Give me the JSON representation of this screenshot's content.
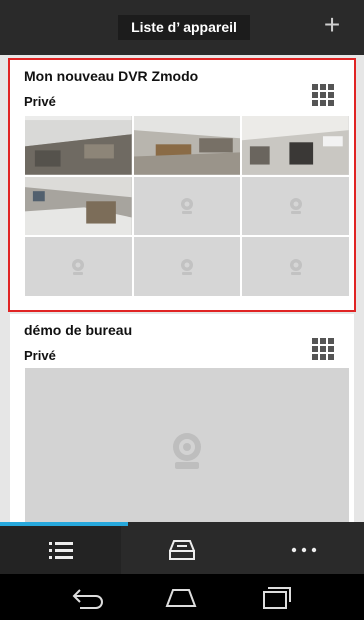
{
  "header": {
    "title": "Liste d’ appareil",
    "add_icon": "plus-icon"
  },
  "devices": [
    {
      "name": "Mon nouveau DVR Zmodo",
      "privacy": "Privé",
      "selected": true,
      "view_icon": "grid-view-icon",
      "cameras": [
        {
          "state": "live"
        },
        {
          "state": "live"
        },
        {
          "state": "live"
        },
        {
          "state": "live"
        },
        {
          "state": "offline"
        },
        {
          "state": "offline"
        },
        {
          "state": "offline"
        },
        {
          "state": "offline"
        },
        {
          "state": "offline"
        }
      ]
    },
    {
      "name": "démo de bureau",
      "privacy": "Privé",
      "selected": false,
      "view_icon": "grid-view-icon",
      "cameras": [
        {
          "state": "offline"
        }
      ]
    }
  ],
  "bottom_tabs": [
    {
      "icon": "list-icon",
      "active": true
    },
    {
      "icon": "tray-icon",
      "active": false
    },
    {
      "icon": "more-icon",
      "active": false
    }
  ],
  "system_nav": [
    "back-icon",
    "home-icon",
    "recents-icon"
  ],
  "colors": {
    "header_bg": "#2a2a2a",
    "selected_border": "#e02424",
    "tab_indicator": "#27a8dc"
  }
}
